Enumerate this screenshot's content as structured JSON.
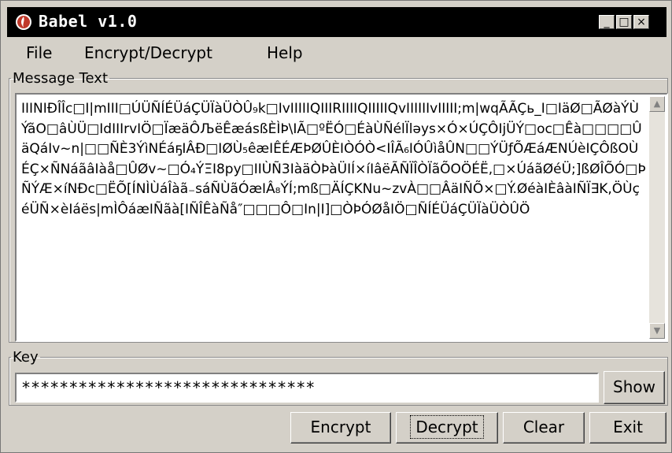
{
  "window": {
    "title": "Babel v1.0",
    "controls": {
      "minimize": "_",
      "maximize": "□",
      "close": "×"
    }
  },
  "menu": {
    "items": [
      "File",
      "Encrypt/Decrypt",
      "Help"
    ]
  },
  "message": {
    "label": "Message Text",
    "text": "IIINIÐÎÎc□I|mIII□ÚÜÑÍÉÜáÇÜÏàÜÒÛ₉k□IvIIIIIQIIIRIIIIQIIIIIQvIIIIIIvIIIII;m|wqÃÃÇь_I□IäØ□ÃØàÝÙÝãO□âÙÜ□IdIIIrvIÖ□ÏæäÔЉëÊæásßÈÌÞ\\IÃ□ºËÓ□ÉàÙÑélÏləys×Ó×ÚÇÔIjÜÝ□oc□Êà□□□□ÛäQáIv~n|□□ÑÈ3ÝìNÉáҕIÂÐ□IØÙ₅êæIÊÉÆÞØÛÈIÒÓÒ<IÎÃ₆IÓÛìåÛN□□ÝÜƒÕÆáÆNÚèIÇÔßOÙÉÇ×ÑNáãâIàå□ÛØv~□Ó₄ÝΞI8py□IIÙÑ3IàäÒÞàÜIÍ×íIâëÃÑÏÎÒÏãÕOÖÉË,□×ÚáãØéÜ;]ßØÎÕÓ□ÞÑÝÆ×íNÐc□ËÕ[ÍNÌÙáÎàã₋sáÑÙãÓæIÂ₈ÝÍ;mß□ÄÍÇKNu~zvÀ□□ÂäIÑÕ×□Ý.ØéàIÈâàIÑÏ∃K,ÖÙçéÜÑ×èIáës|mÌÔáæIÑãà[IÑÎÊàÑå″□□□Ô□In|I]□ÒÞÓØåIÖ□ÑÍÉÜáÇÜÏàÜÒÛÖ"
  },
  "key": {
    "label": "Key",
    "value": "*******************************",
    "show_label": "Show"
  },
  "buttons": {
    "encrypt": "Encrypt",
    "decrypt": "Decrypt",
    "clear": "Clear",
    "exit": "Exit"
  },
  "colors": {
    "titlebar": "#000000",
    "face": "#d4d0c8",
    "icon": "#c0392b"
  }
}
